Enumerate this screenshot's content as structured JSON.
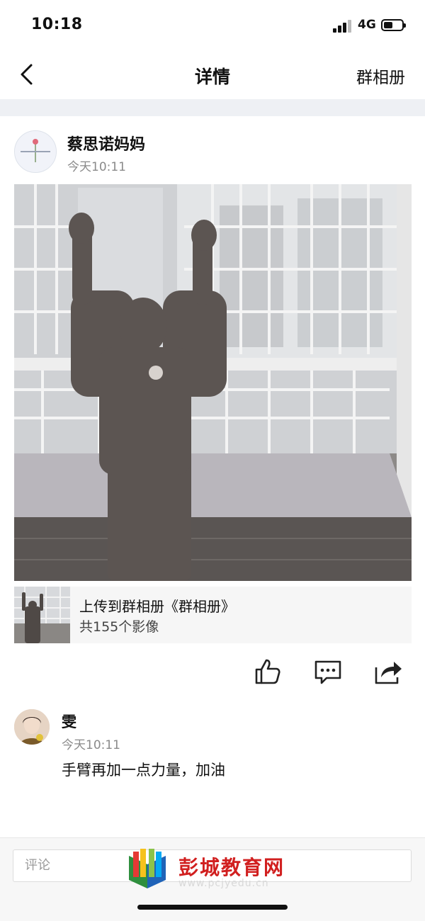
{
  "status_bar": {
    "time": "10:18",
    "network": "4G"
  },
  "nav": {
    "title": "详情",
    "right_link": "群相册"
  },
  "post": {
    "author": "蔡思诺妈妈",
    "time": "今天10:11",
    "album": {
      "title": "上传到群相册《群相册》",
      "count": "共155个影像"
    }
  },
  "actions": [
    {
      "name": "like-icon"
    },
    {
      "name": "comment-icon"
    },
    {
      "name": "share-icon"
    }
  ],
  "comments": [
    {
      "author": "雯",
      "time": "今天10:11",
      "text": "手臂再加一点力量，加油"
    }
  ],
  "comment_input": {
    "placeholder": "评论"
  },
  "watermark": {
    "text": "彭城教育网",
    "url": "www.pcjyedu.cn"
  }
}
